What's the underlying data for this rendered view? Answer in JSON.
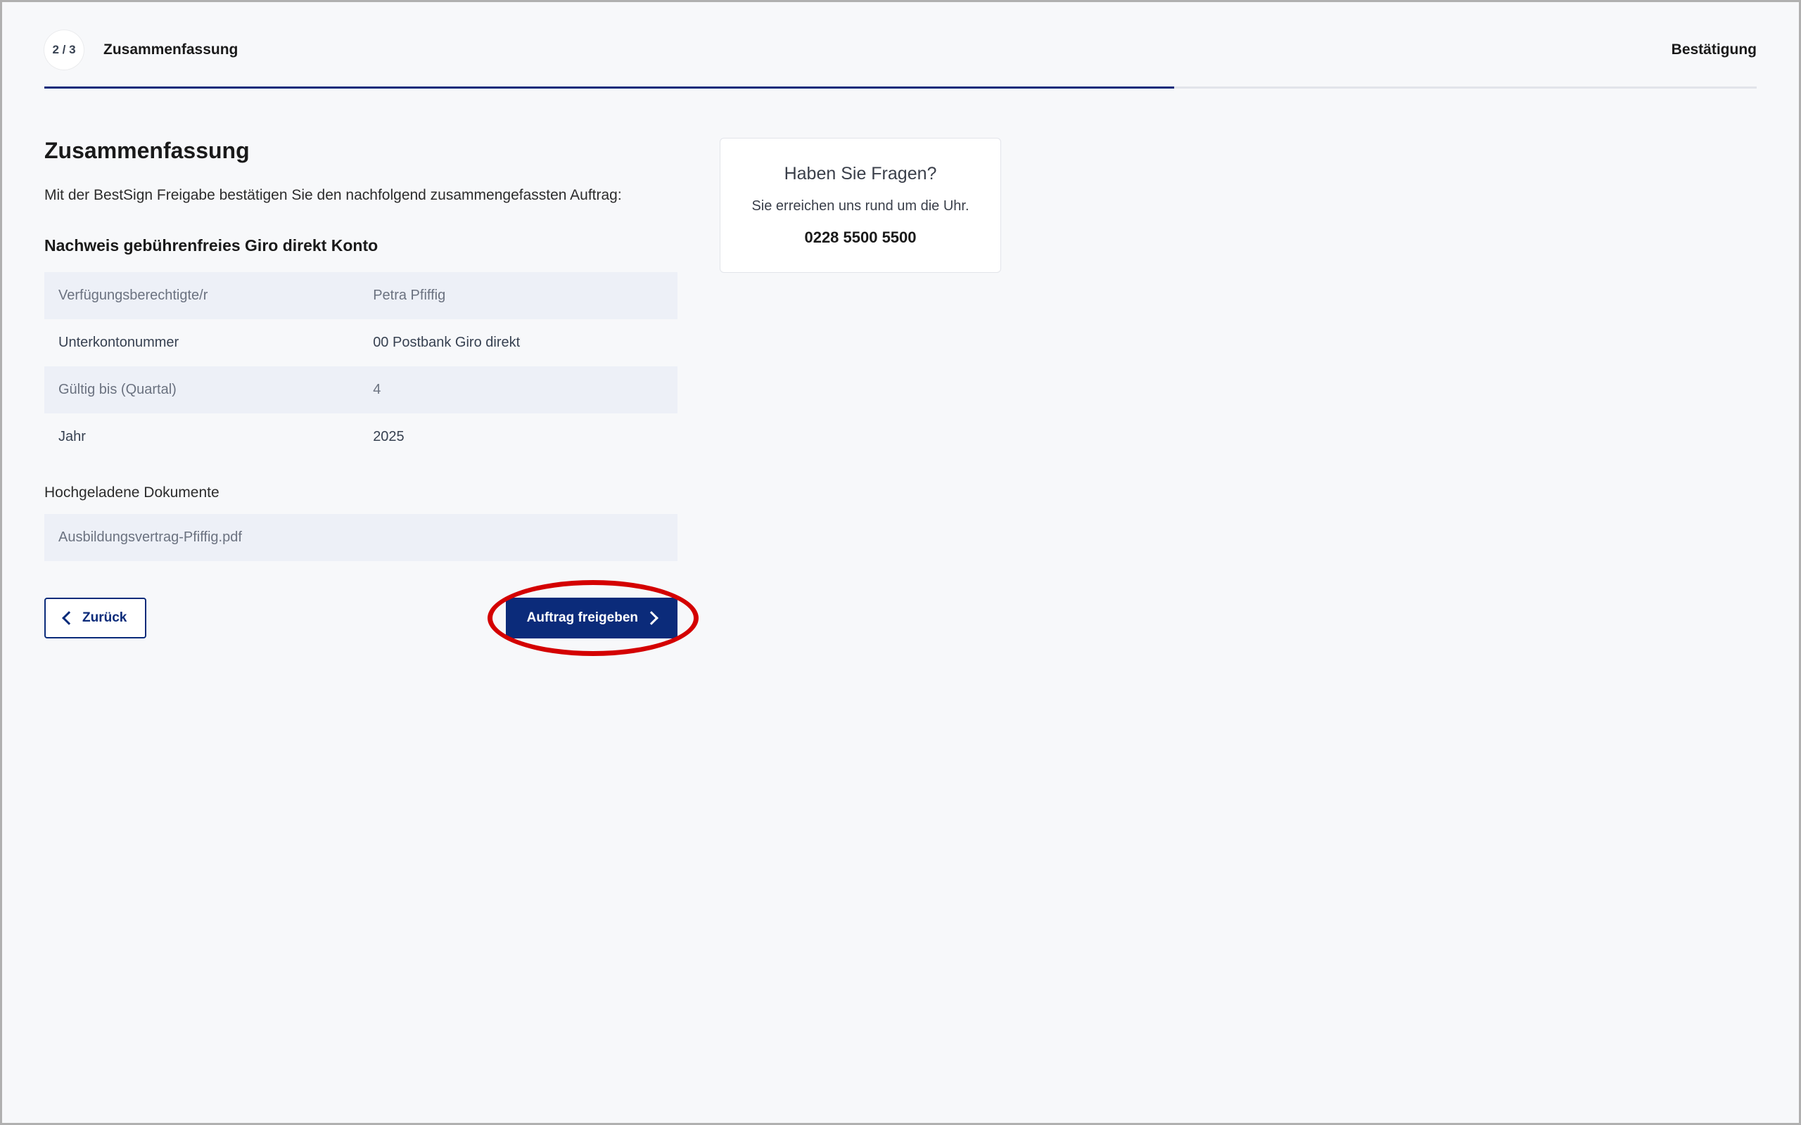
{
  "wizard": {
    "step_badge": "2 / 3",
    "current_label": "Zusammenfassung",
    "next_label": "Bestätigung",
    "progress_percent": 66
  },
  "main": {
    "title": "Zusammenfassung",
    "intro": "Mit der BestSign Freigabe bestätigen Sie den nachfolgend zusammengefassten Auftrag:",
    "section_heading": "Nachweis gebührenfreies Giro direkt Konto",
    "rows": [
      {
        "key": "Verfügungsberechtigte/r",
        "val": "Petra Pfiffig"
      },
      {
        "key": "Unterkontonummer",
        "val": "00 Postbank Giro direkt"
      },
      {
        "key": "Gültig bis (Quartal)",
        "val": "4"
      },
      {
        "key": "Jahr",
        "val": "2025"
      }
    ],
    "uploaded_heading": "Hochgeladene Dokumente",
    "uploaded_file": "Ausbildungsvertrag-Pfiffig.pdf"
  },
  "actions": {
    "back_label": "Zurück",
    "submit_label": "Auftrag freigeben"
  },
  "sidebar": {
    "title": "Haben Sie Fragen?",
    "text": "Sie erreichen uns rund um die Uhr.",
    "phone": "0228 5500 5500"
  }
}
